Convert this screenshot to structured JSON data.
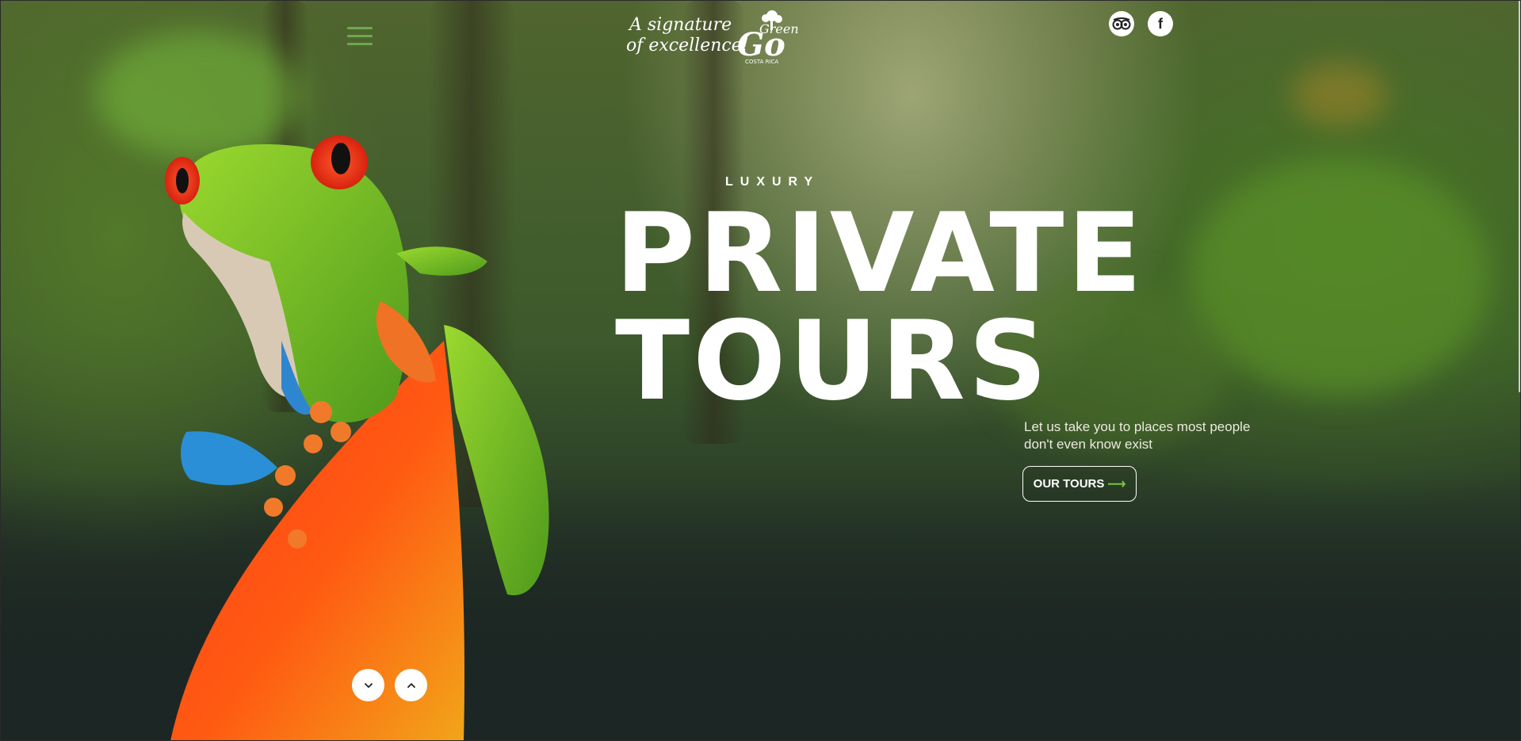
{
  "header": {
    "menu_icon": "hamburger-menu-icon",
    "logo": {
      "script_line1": "A signature",
      "script_line2": "of excellence!",
      "brand_mark": "Go",
      "brand_word": "Green",
      "brand_location": "COSTA RICA"
    },
    "social": [
      {
        "name": "tripadvisor",
        "icon": "tripadvisor-icon"
      },
      {
        "name": "facebook",
        "icon": "facebook-icon",
        "glyph": "f"
      }
    ]
  },
  "hero": {
    "kicker": "LUXURY",
    "title_line1": "PRIVATE",
    "title_line2": "TOURS",
    "tagline": "Let us take you to places most people don't even know exist",
    "cta_label": "OUR TOURS",
    "cta_arrow": "⟶"
  },
  "slider": {
    "prev_icon": "chevron-down-icon",
    "next_icon": "chevron-up-icon"
  },
  "colors": {
    "accent_green": "#6fa84e",
    "text_white": "#ffffff",
    "background_dark": "#1c2624"
  }
}
